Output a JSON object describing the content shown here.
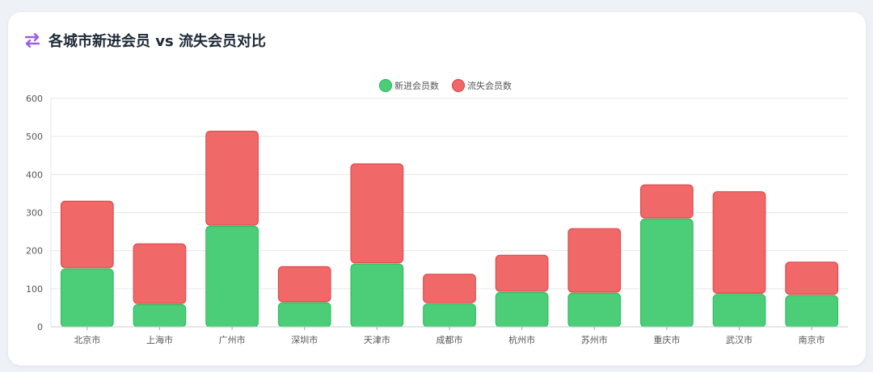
{
  "card": {
    "title": "各城市新进会员 vs 流失会员对比",
    "icon": "swap-arrows-icon"
  },
  "colors": {
    "new_fill": "#4ccd78",
    "new_stroke": "#2fbf62",
    "lost_fill": "#f16869",
    "lost_stroke": "#e04a4c",
    "grid": "#e5e7eb",
    "axis_text": "#555555",
    "icon": "#9b5de5"
  },
  "chart_data": {
    "type": "bar",
    "stacked": true,
    "categories": [
      "北京市",
      "上海市",
      "广州市",
      "深圳市",
      "天津市",
      "成都市",
      "杭州市",
      "苏州市",
      "重庆市",
      "武汉市",
      "南京市"
    ],
    "series": [
      {
        "name": "新进会员数",
        "values": [
          152,
          58,
          264,
          63,
          165,
          60,
          90,
          88,
          283,
          85,
          82
        ]
      },
      {
        "name": "流失会员数",
        "values": [
          178,
          160,
          250,
          95,
          263,
          78,
          98,
          170,
          90,
          270,
          88
        ]
      }
    ],
    "ylim": [
      0,
      600
    ],
    "yticks": [
      0,
      100,
      200,
      300,
      400,
      500,
      600
    ],
    "grid": true,
    "legend": "top-center"
  }
}
